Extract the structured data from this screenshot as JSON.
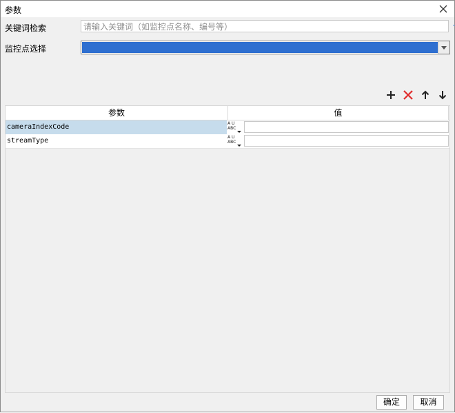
{
  "dialog": {
    "title": "参数",
    "close_icon": "close-icon"
  },
  "keyword": {
    "label": "关键词检索",
    "placeholder": "请输入关键词（如监控点名称、编号等）"
  },
  "monitor": {
    "label": "监控点选择",
    "selected_value": "",
    "highlight_color": "#2e6fd0"
  },
  "toolbar": {
    "add_icon": "plus-icon",
    "delete_icon": "delete-x-icon",
    "up_icon": "arrow-up-icon",
    "down_icon": "arrow-down-icon",
    "delete_color": "#e02b2b"
  },
  "table": {
    "columns": [
      "参数",
      "值"
    ],
    "rows": [
      {
        "name": "cameraIndexCode",
        "type_icon": "abc-type-icon",
        "type_top": "A U",
        "type_bottom": "ABC",
        "value": "",
        "selected": true
      },
      {
        "name": "streamType",
        "type_icon": "abc-type-icon",
        "type_top": "A U",
        "type_bottom": "ABC",
        "value": "",
        "selected": false
      }
    ]
  },
  "footer": {
    "ok_label": "确定",
    "cancel_label": "取消"
  }
}
